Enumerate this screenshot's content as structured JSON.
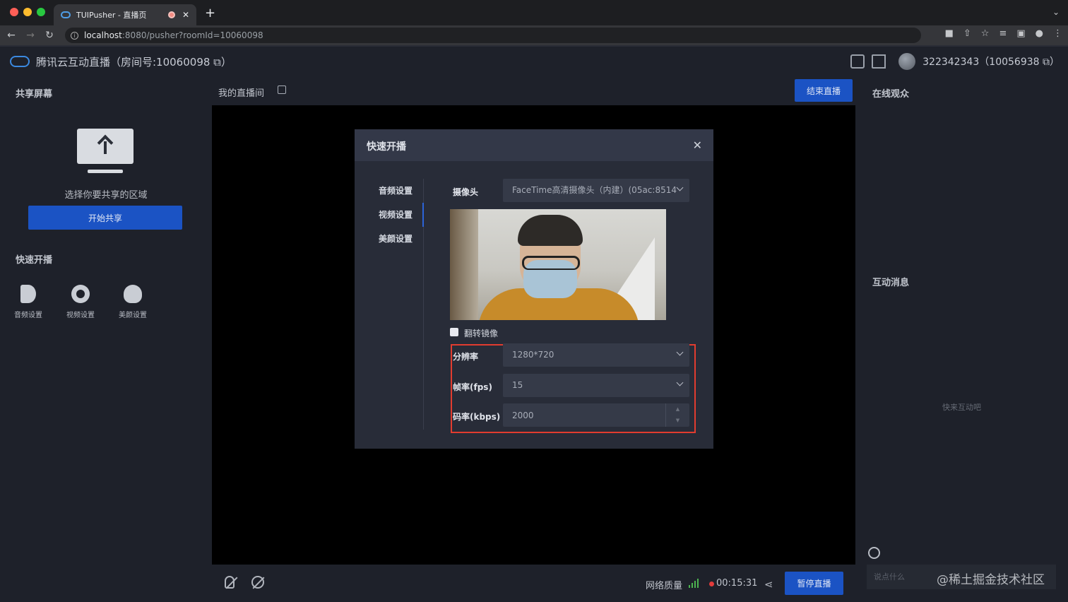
{
  "browser": {
    "tab_title": "TUIPusher - 直播页",
    "tab_close": "✕",
    "new_tab": "+",
    "url_host": "localhost",
    "url_rest": ":8080/pusher?roomId=10060098",
    "collapse": "⌄",
    "info": "i"
  },
  "app": {
    "title": "腾讯云互动直播（房间号:10060098 ⧉）",
    "user": "322342343（10056938 ⧉）"
  },
  "left": {
    "share_title": "共享屏幕",
    "share_hint": "选择你要共享的区域",
    "share_button": "开始共享",
    "quick_title": "快速开播",
    "items": [
      {
        "label": "音频设置",
        "icon": "speaker-icon"
      },
      {
        "label": "视频设置",
        "icon": "webcam-icon"
      },
      {
        "label": "美颜设置",
        "icon": "face-icon"
      }
    ]
  },
  "center": {
    "room_title": "我的直播间",
    "end_button": "结束直播",
    "net_quality": "网络质量",
    "timer": "00:15:31",
    "pause_button": "暂停直播",
    "share_glyph": "⋖"
  },
  "right": {
    "audience_title": "在线观众",
    "chat_title": "互动消息",
    "empty_hint": "快来互动吧",
    "chat_placeholder": "说点什么",
    "watermark": "@稀土掘金技术社区"
  },
  "modal": {
    "title": "快速开播",
    "close": "✕",
    "nav": [
      "音频设置",
      "视频设置",
      "美颜设置"
    ],
    "active_nav": 1,
    "camera_label": "摄像头",
    "camera_value": "FaceTime高清摄像头（内建）(05ac:8514",
    "mirror_label": "翻转镜像",
    "resolution_label": "分辨率",
    "resolution_value": "1280*720",
    "fps_label": "帧率(fps)",
    "fps_value": "15",
    "bitrate_label": "码率(kbps)",
    "bitrate_value": "2000",
    "spin_up": "▲",
    "spin_down": "▼"
  },
  "colors": {
    "accent_blue": "#1b53c4",
    "highlight_red": "#e23c2f",
    "signal_green": "#4cb34f",
    "record_red": "#e23b3b"
  }
}
